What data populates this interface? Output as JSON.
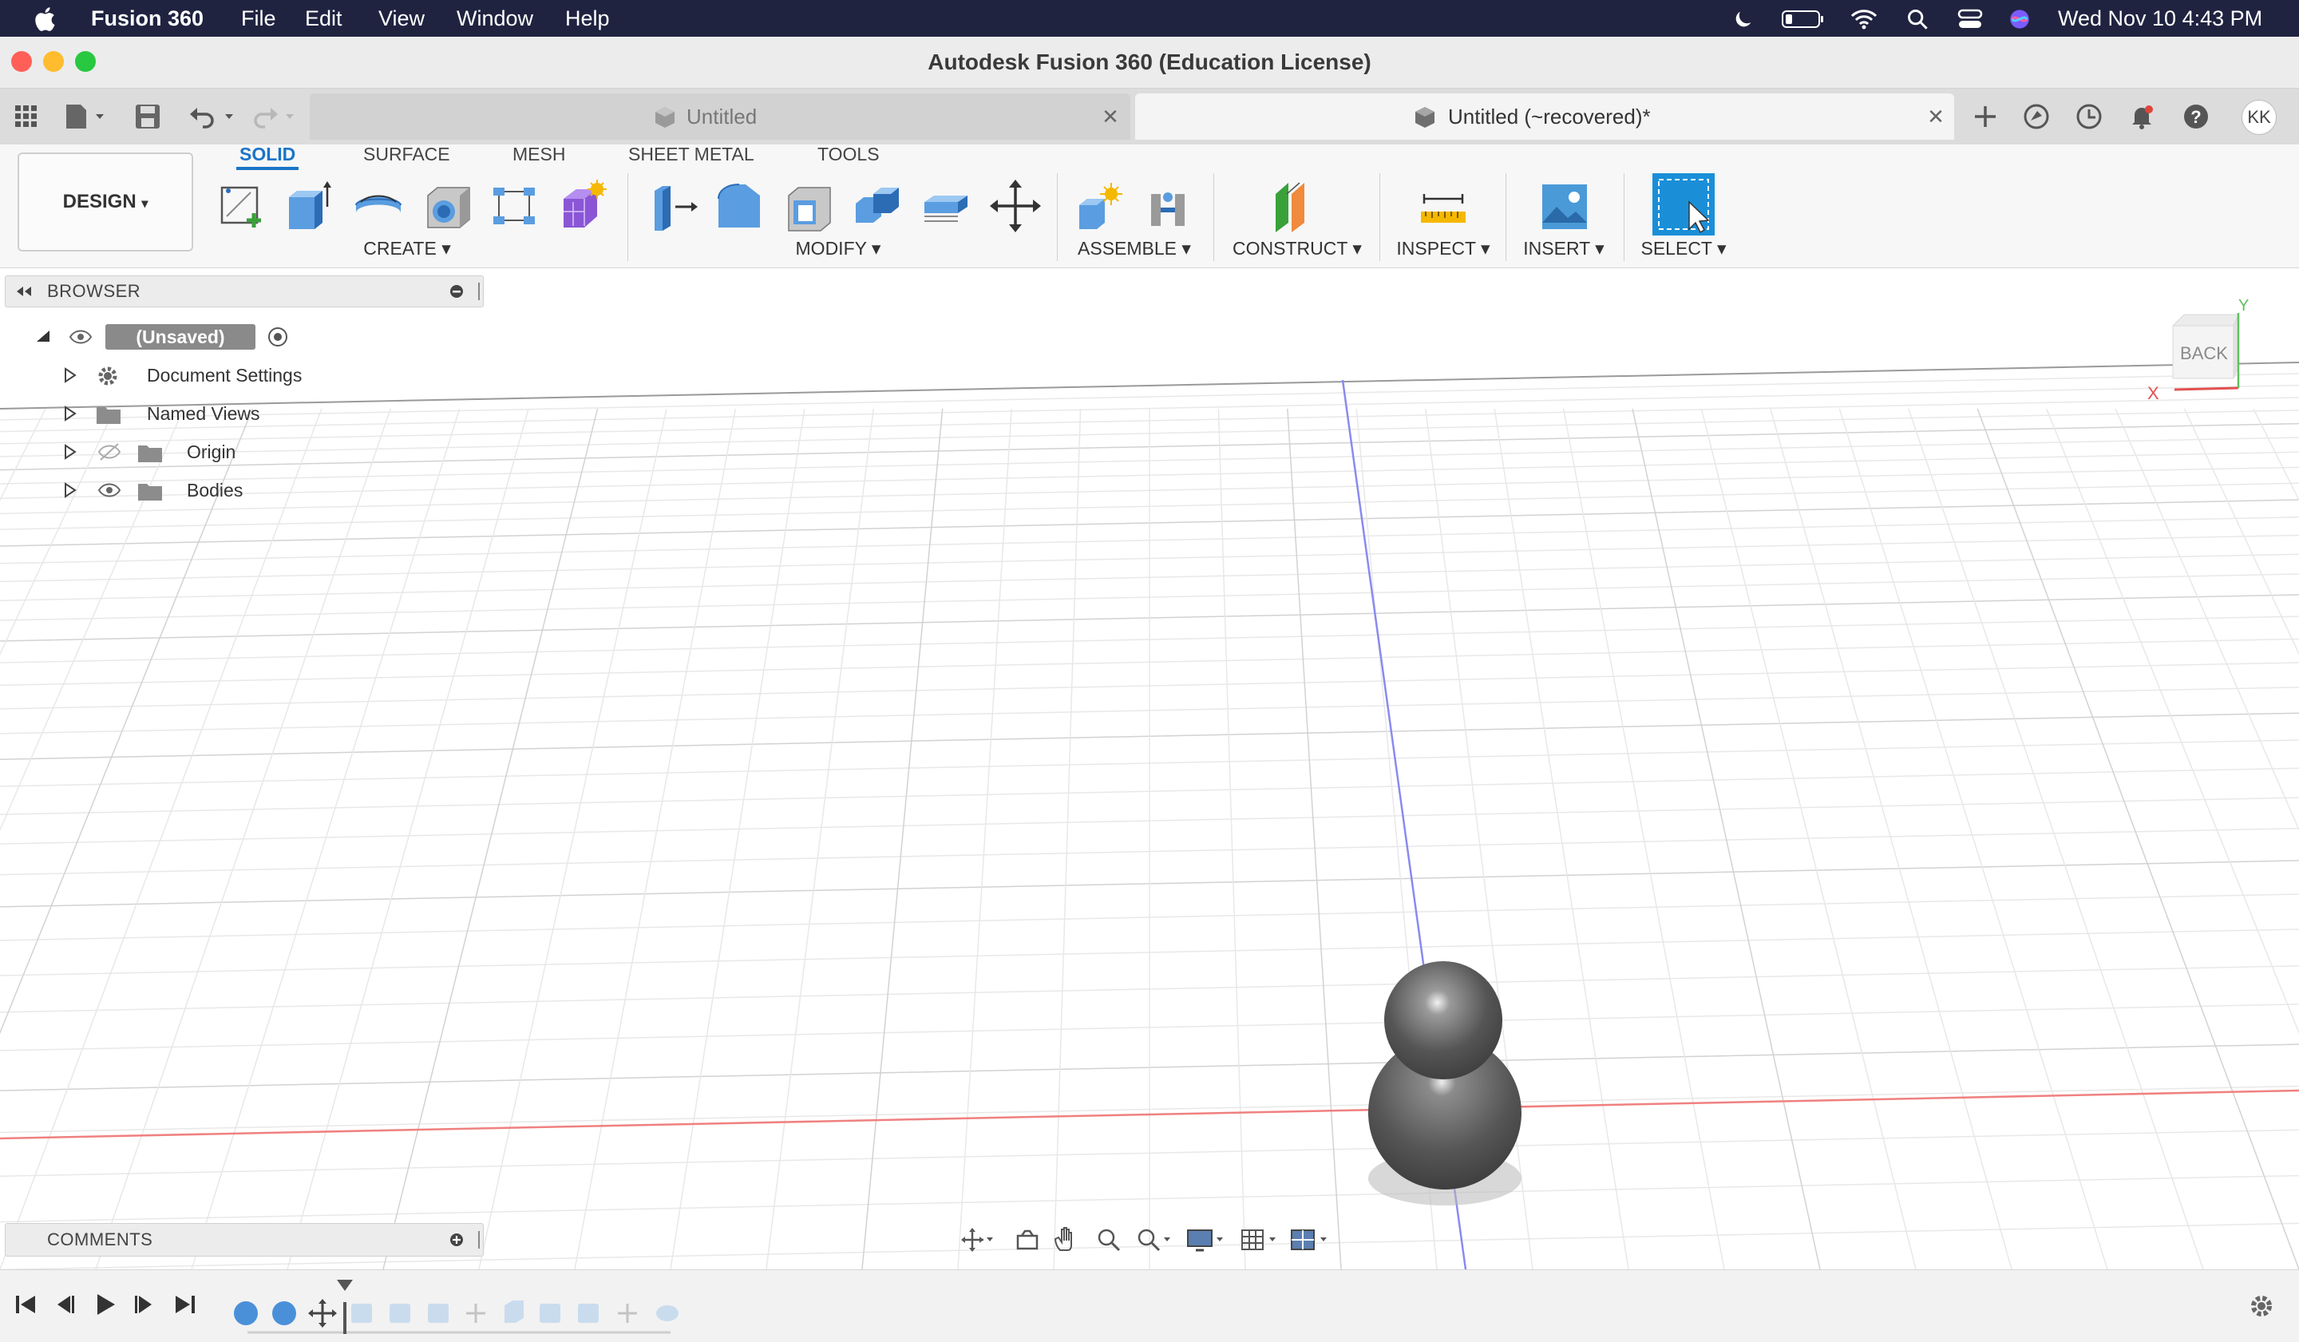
{
  "menubar": {
    "app_name": "Fusion 360",
    "menus": [
      "File",
      "Edit",
      "View",
      "Window",
      "Help"
    ],
    "clock": "Wed Nov 10  4:43 PM",
    "status_icons": [
      "moon-icon",
      "battery-icon",
      "wifi-icon",
      "search-icon",
      "control-center-icon",
      "siri-icon"
    ]
  },
  "window": {
    "title": "Autodesk Fusion 360 (Education License)"
  },
  "tabs": [
    {
      "label": "Untitled",
      "active": false
    },
    {
      "label": "Untitled (~recovered)*",
      "active": true
    }
  ],
  "user": {
    "initials": "KK"
  },
  "ribbon": {
    "workspace": "DESIGN",
    "tabs": [
      "SOLID",
      "SURFACE",
      "MESH",
      "SHEET METAL",
      "TOOLS"
    ],
    "active_tab": "SOLID",
    "groups": [
      "CREATE",
      "MODIFY",
      "ASSEMBLE",
      "CONSTRUCT",
      "INSPECT",
      "INSERT",
      "SELECT"
    ],
    "accent": "#1a74c7"
  },
  "browser": {
    "header": "BROWSER",
    "root": "(Unsaved)",
    "items": [
      "Document Settings",
      "Named Views",
      "Origin",
      "Bodies"
    ]
  },
  "comments": {
    "header": "COMMENTS"
  },
  "viewcube": {
    "face": "BACK",
    "x_axis": "X",
    "y_axis": "Y"
  },
  "colors": {
    "menubar": "#1f2340",
    "grid": "#e3e3e3",
    "x_axis": "#f08080",
    "z_axis": "#8080f0",
    "body": "#5a5a5a"
  }
}
